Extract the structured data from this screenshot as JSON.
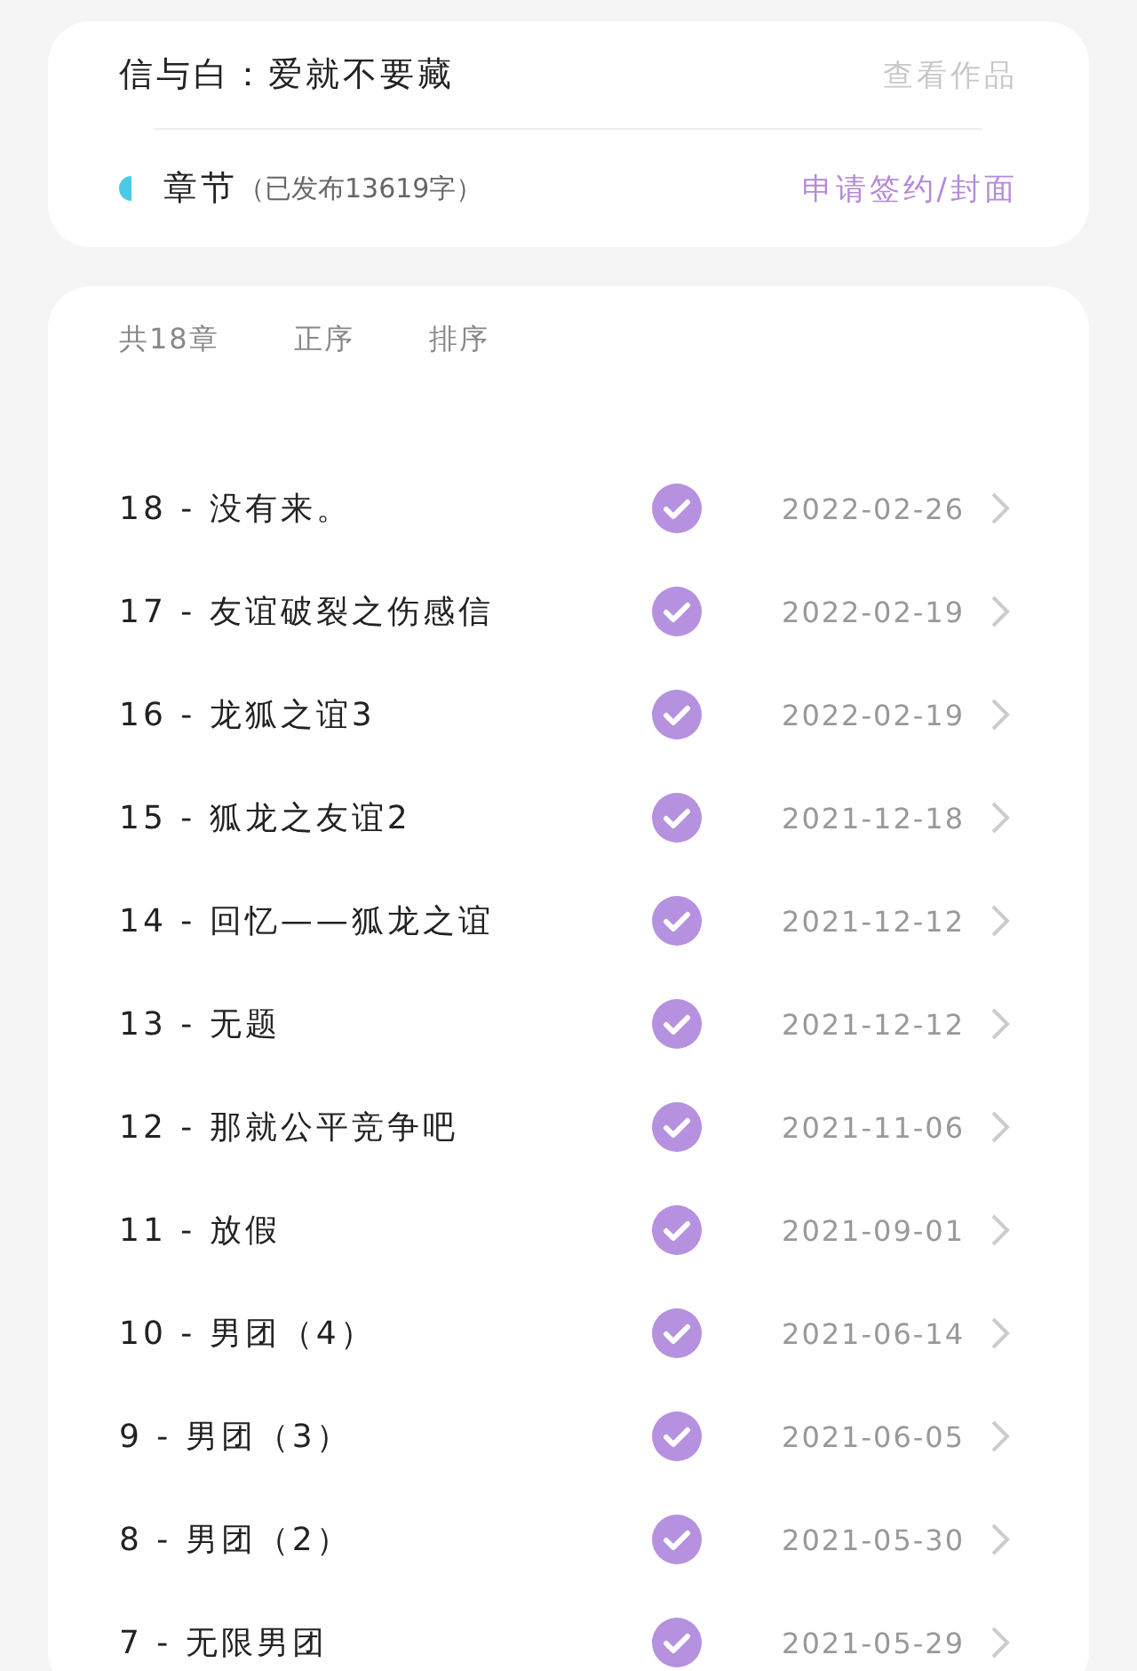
{
  "work": {
    "title": "信与白：爱就不要藏",
    "view_link": "查看作品"
  },
  "chapter_info": {
    "label": "章节",
    "published_note": "（已发布13619字）",
    "action": "申请签约/封面"
  },
  "toolbar": [
    {
      "label": "共18章",
      "selected": false
    },
    {
      "label": "正序",
      "selected": false
    },
    {
      "label": "排序",
      "selected": false
    }
  ],
  "chapters": [
    {
      "title": "18 - 没有来。",
      "published": true,
      "date": "2022-02-26"
    },
    {
      "title": "17 - 友谊破裂之伤感信",
      "published": true,
      "date": "2022-02-19"
    },
    {
      "title": "16 - 龙狐之谊3",
      "published": true,
      "date": "2022-02-19"
    },
    {
      "title": "15 - 狐龙之友谊2",
      "published": true,
      "date": "2021-12-18"
    },
    {
      "title": "14 - 回忆——狐龙之谊",
      "published": true,
      "date": "2021-12-12"
    },
    {
      "title": "13 - 无题",
      "published": true,
      "date": "2021-12-12"
    },
    {
      "title": "12 - 那就公平竞争吧",
      "published": true,
      "date": "2021-11-06"
    },
    {
      "title": "11 - 放假",
      "published": true,
      "date": "2021-09-01"
    },
    {
      "title": "10 - 男团（4）",
      "published": true,
      "date": "2021-06-14"
    },
    {
      "title": "9 - 男团（3）",
      "published": true,
      "date": "2021-06-05"
    },
    {
      "title": "8 - 男团（2）",
      "published": true,
      "date": "2021-05-30"
    },
    {
      "title": "7 - 无限男团",
      "published": true,
      "date": "2021-05-29"
    }
  ]
}
